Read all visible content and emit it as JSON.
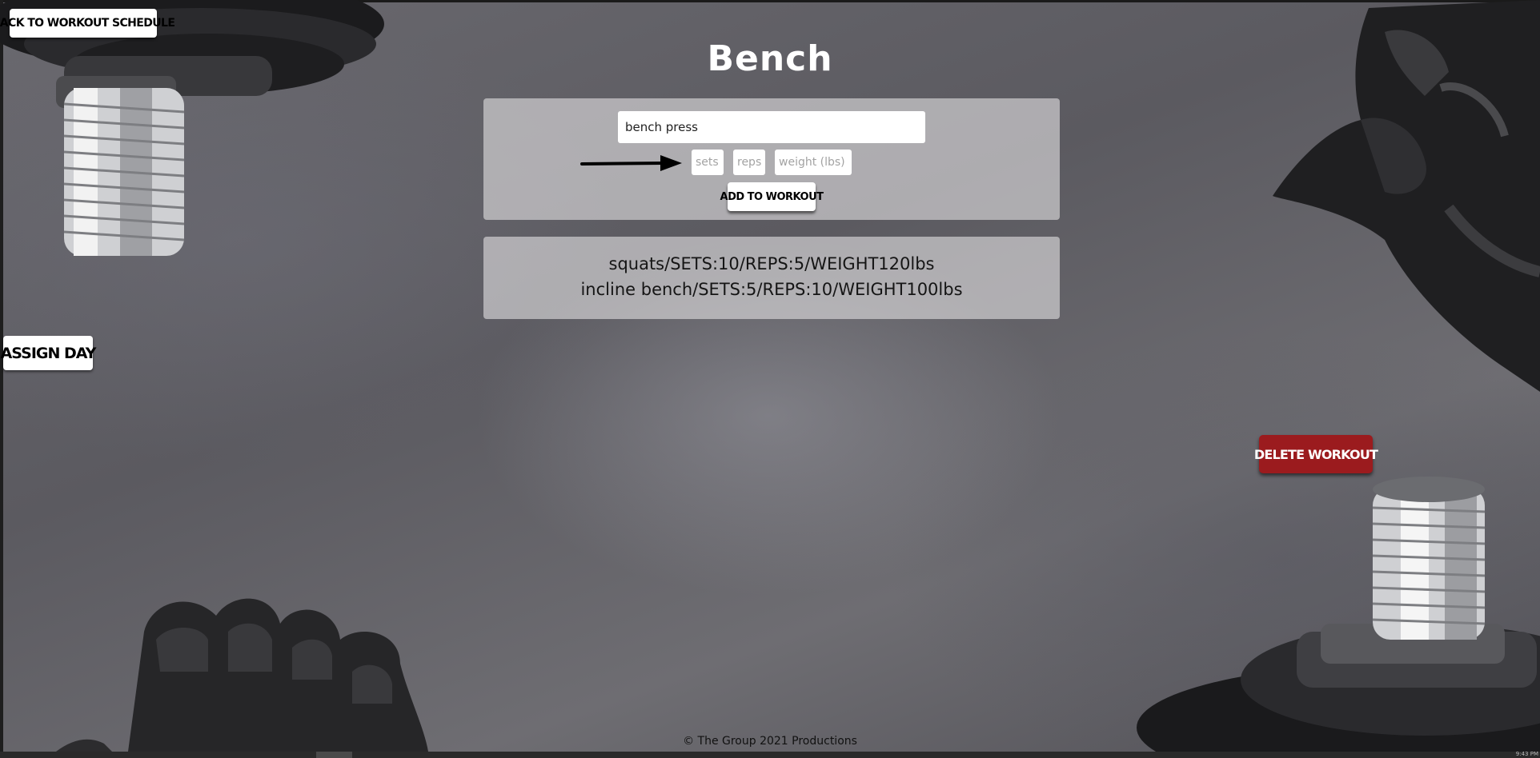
{
  "nav": {
    "back_label": "BACK TO WORKOUT SCHEDULE",
    "assign_label": "ASSIGN DAY",
    "delete_label": "DELETE WORKOUT"
  },
  "page": {
    "title": "Bench"
  },
  "form": {
    "exercise_value": "bench press",
    "sets_placeholder": "sets",
    "reps_placeholder": "reps",
    "weight_placeholder": "weight (lbs)",
    "add_label": "ADD TO WORKOUT"
  },
  "workouts": [
    {
      "text": "squats/SETS:10/REPS:5/WEIGHT120lbs"
    },
    {
      "text": "incline bench/SETS:5/REPS:10/WEIGHT100lbs"
    }
  ],
  "footer": {
    "text": "© The Group 2021 Productions"
  },
  "taskbar": {
    "clock": "9:43 PM"
  },
  "colors": {
    "delete_button": "#9b1b1e",
    "panel": "#e1dee1",
    "background": "#5b5a60"
  },
  "icons": [
    "dumbbell-icon",
    "glove-icon",
    "arrow-right-icon"
  ]
}
